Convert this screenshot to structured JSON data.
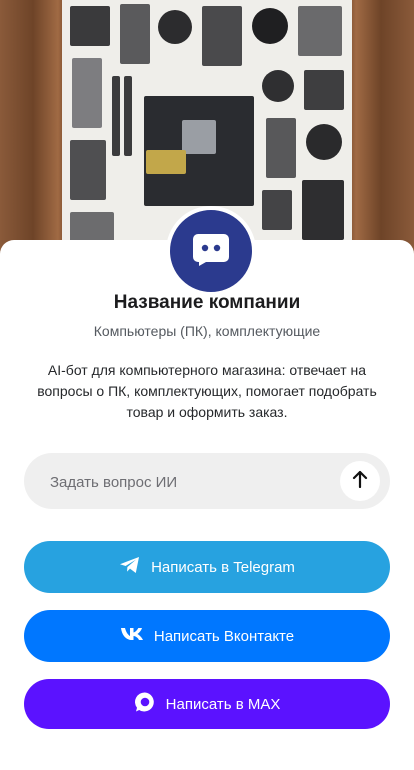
{
  "company": {
    "name": "Название компании",
    "category": "Компьютеры (ПК), комплектующие",
    "description": "AI-бот для компьютерного магазина: отвечает на вопросы о ПК, комплектующих, помогает подобрать товар и оформить заказ."
  },
  "ask": {
    "placeholder": "Задать вопрос ИИ"
  },
  "buttons": {
    "telegram": "Написать в Telegram",
    "vk": "Написать Вконтакте",
    "max": "Написать в MAX"
  },
  "colors": {
    "telegram": "#27a2e0",
    "vk": "#0077ff",
    "max": "#5b12ff",
    "avatar": "#2b3a8e"
  },
  "icons": {
    "avatar": "chat-bot-icon",
    "send": "arrow-up-icon",
    "telegram": "telegram-icon",
    "vk": "vk-icon",
    "max": "max-icon"
  }
}
